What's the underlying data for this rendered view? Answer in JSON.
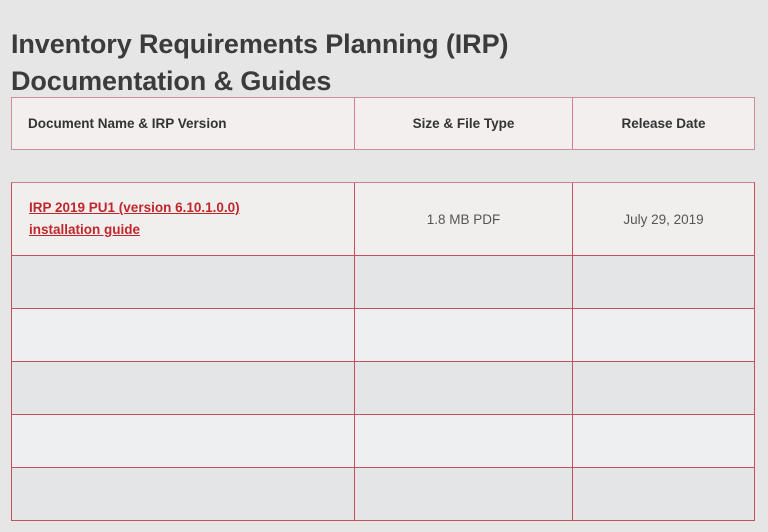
{
  "page": {
    "title_line_1": "Inventory Requirements Planning (IRP)",
    "title_line_2": "Documentation & Guides",
    "title_full": "Inventory Requirements Planning (IRP)\nDocumentation & Guides",
    "background_color": "#e6e6e6",
    "heading_color": "#3b3b3b"
  },
  "table": {
    "border_color": "#c4505c",
    "header_border_color": "#cf7f91",
    "header_background": "#f2efee",
    "link_color": "#c0272d",
    "row_color_odd": "#eeeff0",
    "row_color_even": "#e3e5e7",
    "columns": [
      {
        "label": "Document Name & IRP Version",
        "align": "left"
      },
      {
        "label": "Size & File Type",
        "align": "center"
      },
      {
        "label": "Release Date",
        "align": "center"
      }
    ],
    "rows": [
      {
        "document_name": "IRP 2019 PU1 (version 6.10.1.0.0) installation guide",
        "is_link": true,
        "size_file_type": "1.8 MB PDF",
        "release_date": "July 29, 2019"
      },
      {
        "document_name": "",
        "is_link": false,
        "size_file_type": "",
        "release_date": ""
      },
      {
        "document_name": "",
        "is_link": false,
        "size_file_type": "",
        "release_date": ""
      },
      {
        "document_name": "",
        "is_link": false,
        "size_file_type": "",
        "release_date": ""
      },
      {
        "document_name": "",
        "is_link": false,
        "size_file_type": "",
        "release_date": ""
      },
      {
        "document_name": "",
        "is_link": false,
        "size_file_type": "",
        "release_date": ""
      }
    ]
  }
}
